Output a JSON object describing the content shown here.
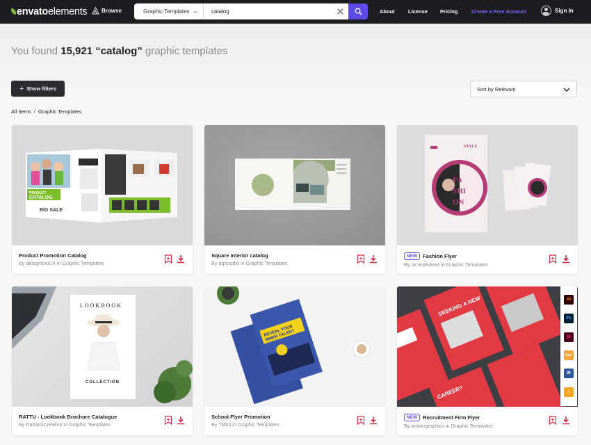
{
  "nav": {
    "logo_prefix": "envato",
    "logo_suffix": "elements",
    "browse_label": "Browse",
    "search_category": "Graphic Templates",
    "search_value": "catalog",
    "links": {
      "about": "About",
      "license": "License",
      "pricing": "Pricing",
      "create": "Create a Free Account"
    },
    "signin_label": "Sign In"
  },
  "results": {
    "prefix": "You found",
    "count": "15,921",
    "query": "“catalog”",
    "suffix": "graphic templates"
  },
  "filters": {
    "show_label": "Show filters"
  },
  "sort": {
    "label": "Sort by Relevant"
  },
  "breadcrumb": {
    "root": "All Items",
    "sep": "/",
    "current": "Graphic Templates"
  },
  "new_label": "NEW",
  "cards": [
    {
      "title": "Product Promotion Catalog",
      "author": "designsoul14",
      "in": "in",
      "category": "Graphic Templates",
      "by": "By"
    },
    {
      "title": "Square Interior catalog",
      "author": "aqrstudio",
      "in": "in",
      "category": "Graphic Templates",
      "by": "By"
    },
    {
      "title": "Fashion Flyer",
      "author": "uicreativenet",
      "in": "in",
      "category": "Graphic Templates",
      "by": "By",
      "is_new": true
    },
    {
      "title": "RATTU - Lookbook Brochure Catalogue",
      "author": "RahardiCreative",
      "in": "in",
      "category": "Graphic Templates",
      "by": "By"
    },
    {
      "title": "School Flyer Promotion",
      "author": "TMint",
      "in": "in",
      "category": "Graphic Templates",
      "by": "By"
    },
    {
      "title": "Recruitment Firm Flyer",
      "author": "ambergraphics",
      "in": "in",
      "category": "Graphic Templates",
      "by": "By",
      "is_new": true
    }
  ],
  "thumb_text": {
    "catalog": "PRODUCT CATALOG",
    "big_sale": "BIG SALE",
    "style": "STYLE",
    "fashion": "FA SHI ON",
    "lookbook": "LOOKBOOK",
    "collection": "COLLECTION",
    "reveal": "REVEAL YOUR INNER TALENT",
    "seeking": "SEEKING A NEW CAREER?"
  },
  "app_icons": [
    "Ai",
    "Ps",
    "Id",
    "Eps",
    "W",
    "/"
  ],
  "colors": {
    "accent": "#5d4be8",
    "brand_green": "#82b541",
    "action_red": "#d42b4a",
    "navbar": "#1b1d20"
  }
}
